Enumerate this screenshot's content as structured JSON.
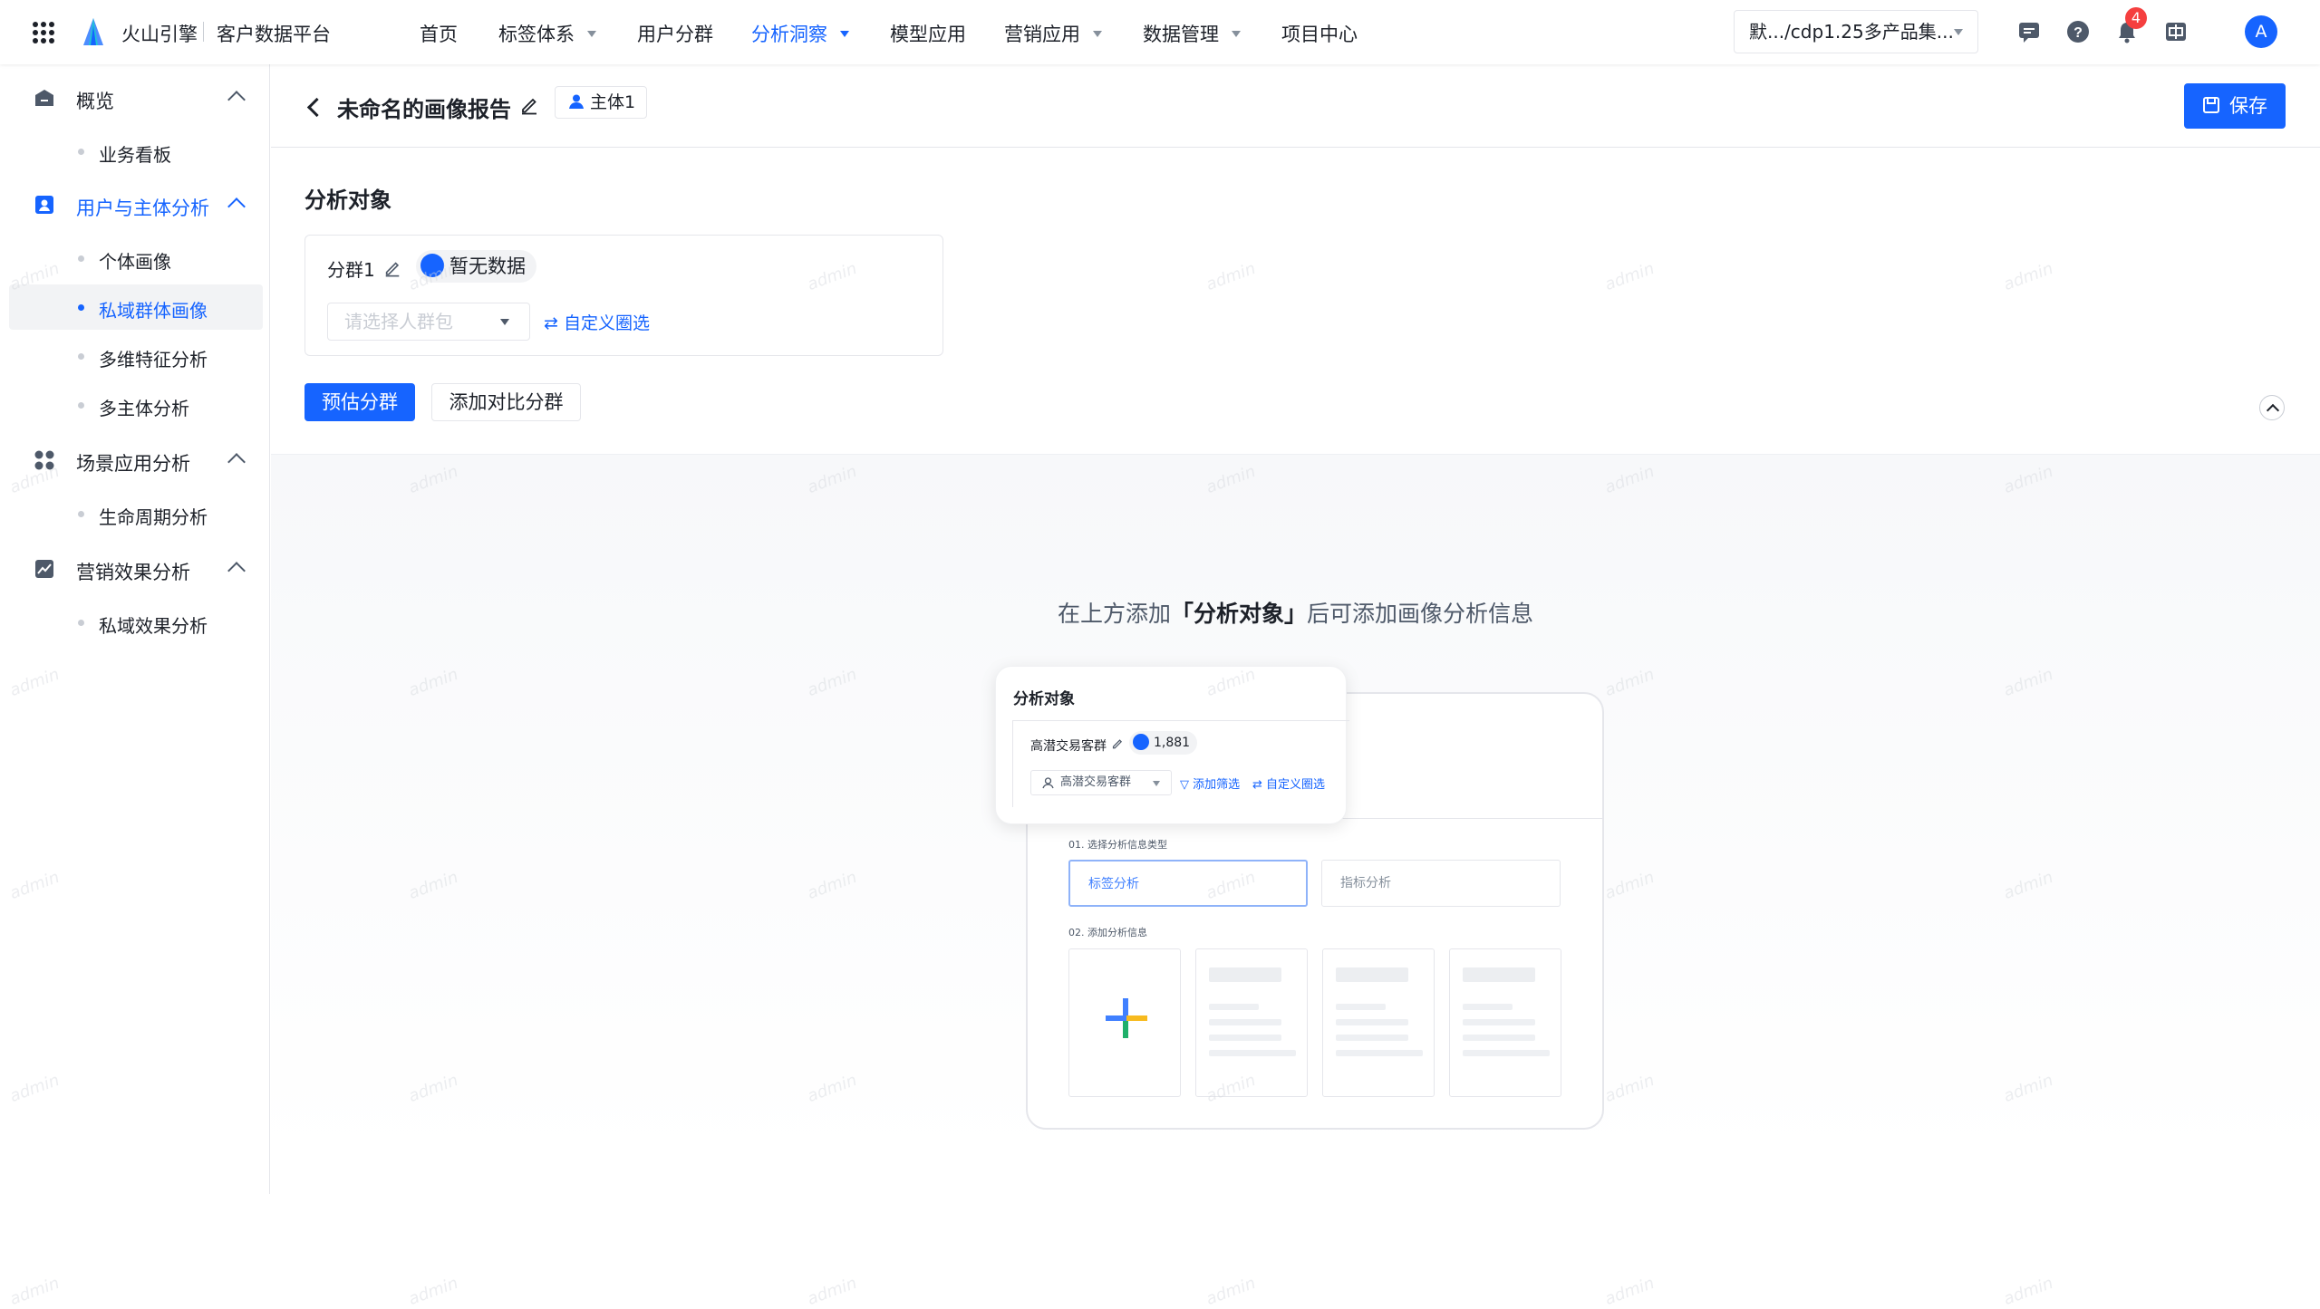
{
  "topbar": {
    "brand": "火山引擎",
    "product": "客户数据平台",
    "nav": [
      {
        "label": "首页",
        "has_caret": false,
        "active": false
      },
      {
        "label": "标签体系",
        "has_caret": true,
        "active": false
      },
      {
        "label": "用户分群",
        "has_caret": false,
        "active": false
      },
      {
        "label": "分析洞察",
        "has_caret": true,
        "active": true
      },
      {
        "label": "模型应用",
        "has_caret": false,
        "active": false
      },
      {
        "label": "营销应用",
        "has_caret": true,
        "active": false
      },
      {
        "label": "数据管理",
        "has_caret": true,
        "active": false
      },
      {
        "label": "项目中心",
        "has_caret": false,
        "active": false
      }
    ],
    "project_selector": "默.../cdp1.25多产品集...",
    "notification_count": "4",
    "avatar_initial": "A",
    "icons": [
      "apps-grid-icon",
      "message-icon",
      "help-icon",
      "bell-icon",
      "language-switch-icon"
    ]
  },
  "sidebar": {
    "groups": [
      {
        "label": "概览",
        "icon": "home-icon",
        "active": false,
        "items": [
          {
            "label": "业务看板",
            "active": false
          }
        ]
      },
      {
        "label": "用户与主体分析",
        "icon": "user-card-icon",
        "active": true,
        "items": [
          {
            "label": "个体画像",
            "active": false
          },
          {
            "label": "私域群体画像",
            "active": true
          },
          {
            "label": "多维特征分析",
            "active": false
          },
          {
            "label": "多主体分析",
            "active": false
          }
        ]
      },
      {
        "label": "场景应用分析",
        "icon": "apps-icon",
        "active": false,
        "items": [
          {
            "label": "生命周期分析",
            "active": false
          }
        ]
      },
      {
        "label": "营销效果分析",
        "icon": "chart-icon",
        "active": false,
        "items": [
          {
            "label": "私域效果分析",
            "active": false
          }
        ]
      }
    ]
  },
  "header": {
    "title": "未命名的画像报告",
    "subject_tag": "主体1",
    "save_label": "保存"
  },
  "analysis": {
    "section_title": "分析对象",
    "group_name": "分群1",
    "no_data": "暂无数据",
    "crowd_placeholder": "请选择人群包",
    "custom_filter": "自定义圈选",
    "estimate_button": "预估分群",
    "add_compare_button": "添加对比分群"
  },
  "empty_state": {
    "text_before": "在上方添加",
    "text_highlight": "「分析对象」",
    "text_after": "后可添加画像分析信息"
  },
  "illustration": {
    "title": "分析对象",
    "group_name": "高潜交易客群",
    "count": "1,881",
    "select_value": "高潜交易客群",
    "add_filter": "添加筛选",
    "custom_filter": "自定义圈选",
    "step1": "01. 选择分析信息类型",
    "option_tag": "标签分析",
    "option_metric": "指标分析",
    "step2": "02. 添加分析信息"
  },
  "watermark": "admin",
  "colors": {
    "accent": "#1664ff",
    "badge": "#f53f3f"
  }
}
